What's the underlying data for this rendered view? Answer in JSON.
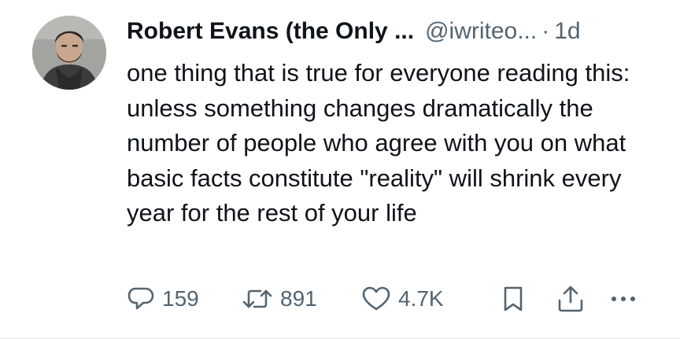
{
  "author": {
    "name": "Robert Evans (the Only ...",
    "handle": "@iwriteo...",
    "separator": "·",
    "time": "1d"
  },
  "tweet": {
    "text": "one thing that is true for everyone reading this: unless something changes dramatically the number of people who agree with you on what basic facts constitute \"reality\" will shrink every year for the rest of your life"
  },
  "actions": {
    "replies": "159",
    "retweets": "891",
    "likes": "4.7K"
  },
  "icons": {
    "reply": "reply-icon",
    "retweet": "retweet-icon",
    "like": "heart-icon",
    "bookmark": "bookmark-icon",
    "share": "share-icon",
    "more": "more-icon"
  },
  "colors": {
    "text": "#0f1419",
    "secondary": "#536471"
  }
}
